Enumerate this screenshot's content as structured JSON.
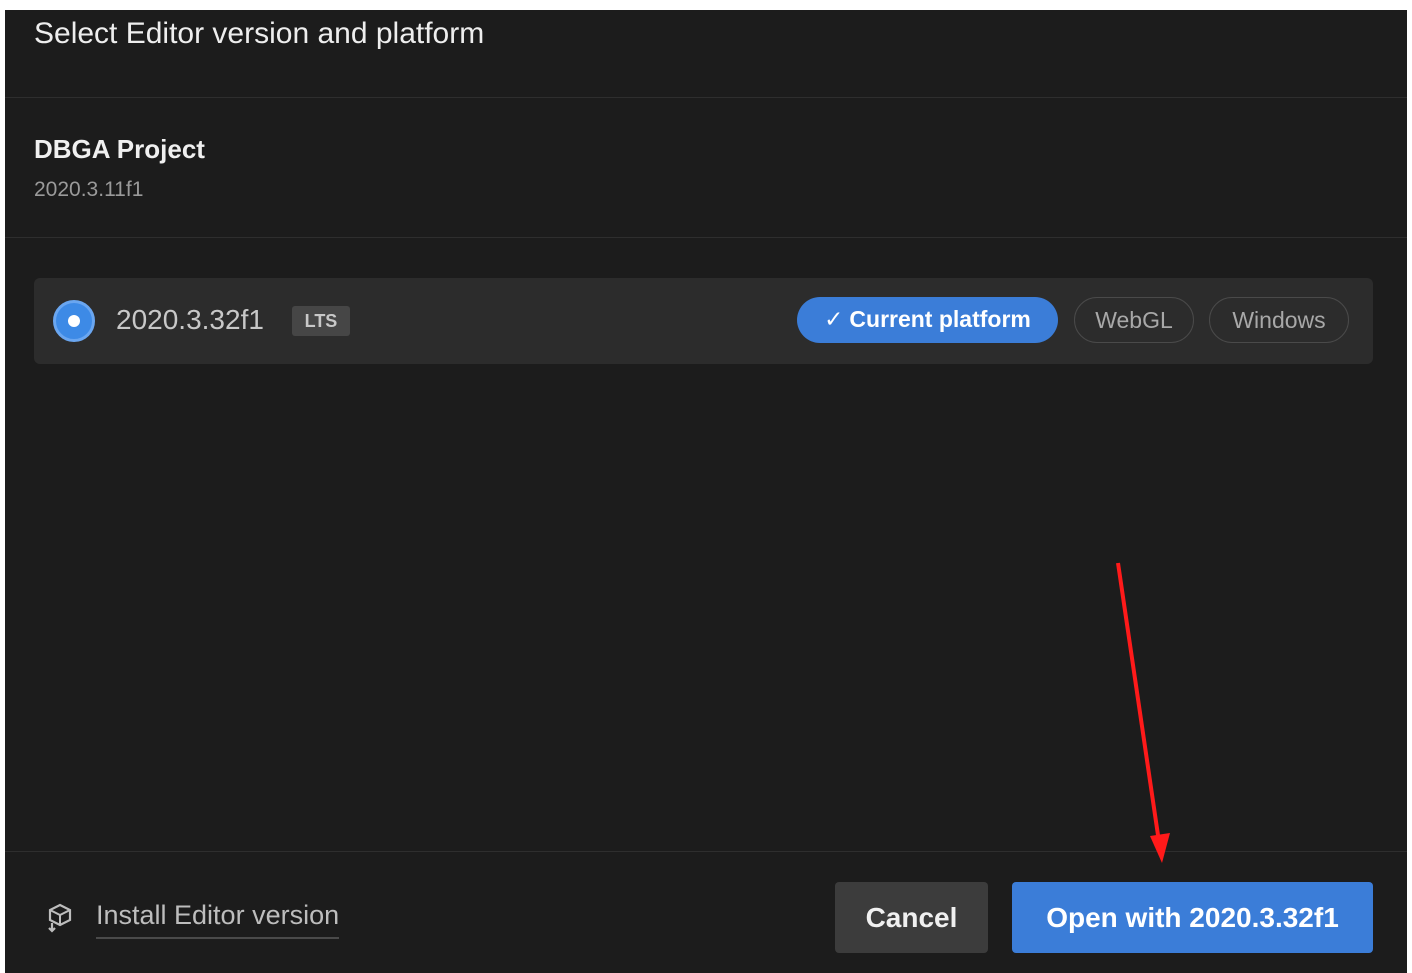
{
  "dialog": {
    "title": "Select Editor version and platform"
  },
  "project": {
    "name": "DBGA Project",
    "version": "2020.3.11f1"
  },
  "editor_option": {
    "version": "2020.3.32f1",
    "badge": "LTS",
    "selected": true,
    "platforms": [
      {
        "label": "Current platform",
        "active": true,
        "icon": "check-icon"
      },
      {
        "label": "WebGL",
        "active": false
      },
      {
        "label": "Windows",
        "active": false
      }
    ]
  },
  "footer": {
    "install_label": "Install Editor version",
    "install_icon": "install-editor-icon",
    "cancel_label": "Cancel",
    "open_label": "Open with 2020.3.32f1"
  },
  "annotation": {
    "type": "red-arrow",
    "color": "#ff0000",
    "points_to": "open-with-button"
  },
  "colors": {
    "background": "#1c1c1c",
    "accent": "#3b7dd8",
    "row_background": "#2c2c2c",
    "cancel_background": "#3c3c3c"
  }
}
